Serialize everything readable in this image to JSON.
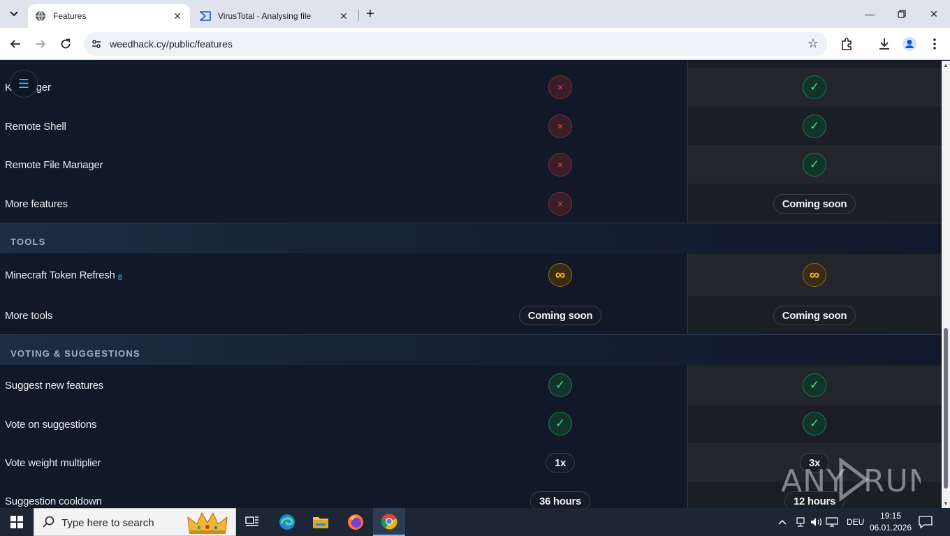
{
  "browser": {
    "tabs": [
      {
        "title": "Features",
        "active": true,
        "favicon": "globe-icon"
      },
      {
        "title": "VirusTotal - Analysing file",
        "active": false,
        "favicon": "virustotal-icon"
      }
    ],
    "url": "weedhack.cy/public/features"
  },
  "page": {
    "rows_top": [
      {
        "label": "Keylogger",
        "free": "x",
        "pro": "check"
      },
      {
        "label": "Remote Shell",
        "free": "x",
        "pro": "check"
      },
      {
        "label": "Remote File Manager",
        "free": "x",
        "pro": "check"
      },
      {
        "label": "More features",
        "free": "x",
        "pro_text": "Coming soon"
      }
    ],
    "sections": {
      "tools": "TOOLS",
      "voting": "VOTING & SUGGESTIONS"
    },
    "tools_rows": [
      {
        "label": "Minecraft Token Refresh",
        "badge": "8",
        "free": "∞",
        "pro": "∞"
      },
      {
        "label": "More tools",
        "free_text": "Coming soon",
        "pro_text": "Coming soon"
      }
    ],
    "voting_rows": [
      {
        "label": "Suggest new features",
        "free": "check",
        "pro": "check"
      },
      {
        "label": "Vote on suggestions",
        "free": "check",
        "pro": "check"
      },
      {
        "label": "Vote weight multiplier",
        "free_text": "1x",
        "pro_text": "3x"
      },
      {
        "label": "Suggestion cooldown",
        "free_text": "36 hours",
        "pro_text": "12 hours"
      }
    ],
    "glyphs": {
      "x": "✕",
      "check": "✓",
      "infinity": "∞"
    }
  },
  "watermark": "ANY RUN",
  "taskbar": {
    "search_placeholder": "Type here to search",
    "language": "DEU",
    "time": "19:15",
    "date": "06.01.2026"
  }
}
